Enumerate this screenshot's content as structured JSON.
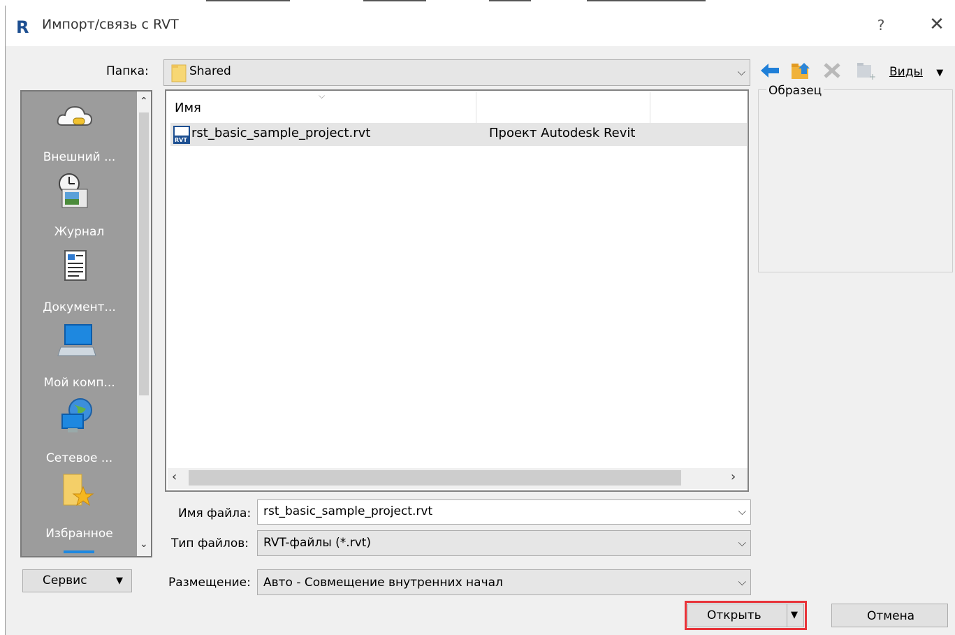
{
  "window": {
    "title": "Импорт/связь с RVT",
    "help_label": "?",
    "close_label": "✕"
  },
  "folder": {
    "label": "Папка:",
    "value": "Shared"
  },
  "toolbar": {
    "views_label": "Виды"
  },
  "places": [
    {
      "label": "Внешний ...",
      "icon": "cloud-icon"
    },
    {
      "label": "Журнал",
      "icon": "history-icon"
    },
    {
      "label": "Документ...",
      "icon": "documents-icon"
    },
    {
      "label": "Мой комп...",
      "icon": "computer-icon"
    },
    {
      "label": "Сетевое ...",
      "icon": "network-icon"
    },
    {
      "label": "Избранное",
      "icon": "favorites-icon"
    }
  ],
  "file_list": {
    "columns": [
      "Имя",
      "",
      ""
    ],
    "rows": [
      {
        "name": "rst_basic_sample_project.rvt",
        "type": "Проект Autodesk Revit"
      }
    ]
  },
  "preview": {
    "label": "Образец"
  },
  "fields": {
    "filename_label": "Имя файла:",
    "filename_value": "rst_basic_sample_project.rvt",
    "filetype_label": "Тип файлов:",
    "filetype_value": "RVT-файлы  (*.rvt)",
    "placement_label": "Размещение:",
    "placement_value": "Авто - Совмещение внутренних начал"
  },
  "buttons": {
    "tools": "Сервис",
    "open": "Открыть",
    "cancel": "Отмена"
  },
  "colors": {
    "highlight": "#e8343a",
    "revit_blue": "#1d4f91",
    "places_bg": "#9c9c9c"
  }
}
